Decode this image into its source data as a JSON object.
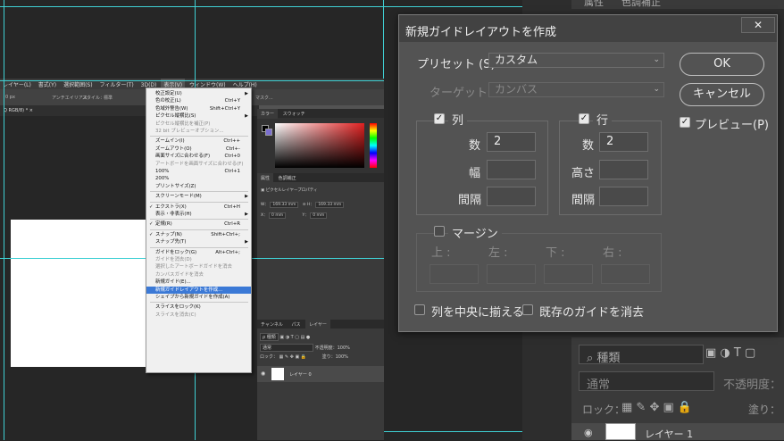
{
  "mini": {
    "menubar": [
      "レイヤー(L)",
      "書式(Y)",
      "選択範囲(S)",
      "フィルター(T)",
      "3D(D)",
      "表示(V)",
      "ウィンドウ(W)",
      "ヘルプ(H)"
    ],
    "opt_px": "0 px",
    "opt_antialias": "アンチエイリアス",
    "opt_style": "スタイル：",
    "opt_style_val": "標準",
    "opt_mask": "マスク...",
    "doc_tab": "Q RGB/8) * ×",
    "color_tabs": [
      "カラー",
      "スウォッチ"
    ],
    "props_tabs": [
      "属性",
      "色調補正"
    ],
    "props_title": "ピクセルレイヤープロパティ",
    "props_w_label": "W：",
    "props_w": "169.33 mm",
    "props_h_label": "H：",
    "props_h": "169.33 mm",
    "props_x_label": "X：",
    "props_x": "0 mm",
    "props_y_label": "Y：",
    "props_y": "0 mm",
    "layers_tabs": [
      "チャンネル",
      "パス",
      "レイヤー"
    ],
    "layers_kind": "ρ 種類",
    "layers_blend": "通常",
    "layers_opacity": "不透明度：100%",
    "layers_lock": "ロック：",
    "layers_fill": "塗り：100%",
    "layer_name": "レイヤー 0"
  },
  "view_menu": {
    "items": [
      {
        "label": "校正設定(U)",
        "shortcut": "",
        "arrow": true,
        "check": false,
        "disabled": false
      },
      {
        "label": "色の校正(L)",
        "shortcut": "Ctrl+Y",
        "arrow": false,
        "check": false,
        "disabled": false
      },
      {
        "label": "色域外警告(W)",
        "shortcut": "Shift+Ctrl+Y",
        "arrow": false,
        "check": false,
        "disabled": false
      },
      {
        "label": "ピクセル縦横比(S)",
        "shortcut": "",
        "arrow": true,
        "check": false,
        "disabled": false
      },
      {
        "label": "ピクセル縦横比を補正(P)",
        "shortcut": "",
        "arrow": false,
        "check": false,
        "disabled": true
      },
      {
        "label": "32 bit プレビューオプション...",
        "shortcut": "",
        "arrow": false,
        "check": false,
        "disabled": true
      },
      {
        "sep": true
      },
      {
        "label": "ズームイン(I)",
        "shortcut": "Ctrl++",
        "arrow": false,
        "check": false,
        "disabled": false
      },
      {
        "label": "ズームアウト(O)",
        "shortcut": "Ctrl+-",
        "arrow": false,
        "check": false,
        "disabled": false
      },
      {
        "label": "画面サイズに合わせる(F)",
        "shortcut": "Ctrl+0",
        "arrow": false,
        "check": false,
        "disabled": false
      },
      {
        "label": "アートボードを画面サイズに合わせる(F)",
        "shortcut": "",
        "arrow": false,
        "check": false,
        "disabled": true
      },
      {
        "label": "100%",
        "shortcut": "Ctrl+1",
        "arrow": false,
        "check": false,
        "disabled": false
      },
      {
        "label": "200%",
        "shortcut": "",
        "arrow": false,
        "check": false,
        "disabled": false
      },
      {
        "label": "プリントサイズ(Z)",
        "shortcut": "",
        "arrow": false,
        "check": false,
        "disabled": false
      },
      {
        "sep": true
      },
      {
        "label": "スクリーンモード(M)",
        "shortcut": "",
        "arrow": true,
        "check": false,
        "disabled": false
      },
      {
        "sep": true
      },
      {
        "label": "エクストラ(X)",
        "shortcut": "Ctrl+H",
        "arrow": false,
        "check": true,
        "disabled": false
      },
      {
        "label": "表示・非表示(H)",
        "shortcut": "",
        "arrow": true,
        "check": false,
        "disabled": false
      },
      {
        "sep": true
      },
      {
        "label": "定規(R)",
        "shortcut": "Ctrl+R",
        "arrow": false,
        "check": true,
        "disabled": false
      },
      {
        "sep": true
      },
      {
        "label": "スナップ(N)",
        "shortcut": "Shift+Ctrl+;",
        "arrow": false,
        "check": true,
        "disabled": false
      },
      {
        "label": "スナップ先(T)",
        "shortcut": "",
        "arrow": true,
        "check": false,
        "disabled": false
      },
      {
        "sep": true
      },
      {
        "label": "ガイドをロック(G)",
        "shortcut": "Alt+Ctrl+;",
        "arrow": false,
        "check": false,
        "disabled": false
      },
      {
        "label": "ガイドを消去(D)",
        "shortcut": "",
        "arrow": false,
        "check": false,
        "disabled": true
      },
      {
        "label": "選択したアートボードガイドを消去",
        "shortcut": "",
        "arrow": false,
        "check": false,
        "disabled": true
      },
      {
        "label": "カンバスガイドを消去",
        "shortcut": "",
        "arrow": false,
        "check": false,
        "disabled": true
      },
      {
        "label": "新規ガイド(E)...",
        "shortcut": "",
        "arrow": false,
        "check": false,
        "disabled": false
      },
      {
        "label": "新規ガイドレイアウトを作成...",
        "shortcut": "",
        "arrow": false,
        "check": false,
        "disabled": false,
        "highlight": true
      },
      {
        "label": "シェイプから新規ガイドを作成(A)",
        "shortcut": "",
        "arrow": false,
        "check": false,
        "disabled": false
      },
      {
        "sep": true
      },
      {
        "label": "スライスをロック(K)",
        "shortcut": "",
        "arrow": false,
        "check": false,
        "disabled": false
      },
      {
        "label": "スライスを消去(C)",
        "shortcut": "",
        "arrow": false,
        "check": false,
        "disabled": true
      }
    ]
  },
  "bg_panel": {
    "tabs": [
      "属性",
      "色調補正"
    ],
    "kind": "種類",
    "blend": "通常",
    "opacity_label": "不透明度：",
    "lock_label": "ロック：",
    "fill_label": "塗り：",
    "layer_name": "レイヤー 1"
  },
  "dialog": {
    "title": "新規ガイドレイアウトを作成",
    "close_glyph": "✕",
    "preset_label": "プリセット (S) ：",
    "preset_value": "カスタム",
    "target_label": "ターゲット ：",
    "target_value": "カンバス",
    "columns_label": "列",
    "columns_number_label": "数",
    "columns_number": "2",
    "columns_width_label": "幅",
    "columns_width": "",
    "columns_gutter_label": "間隔",
    "columns_gutter": "",
    "rows_label": "行",
    "rows_number_label": "数",
    "rows_number": "2",
    "rows_height_label": "高さ",
    "rows_height": "",
    "rows_gutter_label": "間隔",
    "rows_gutter": "",
    "margin_label": "マージン",
    "margin_top_label": "上 :",
    "margin_left_label": "左 :",
    "margin_bottom_label": "下 :",
    "margin_right_label": "右 :",
    "center_columns_label": "列を中央に揃える",
    "clear_guides_label": "既存のガイドを消去",
    "ok_label": "OK",
    "cancel_label": "キャンセル",
    "preview_label": "プレビュー(P)",
    "check_glyph": "✓"
  }
}
